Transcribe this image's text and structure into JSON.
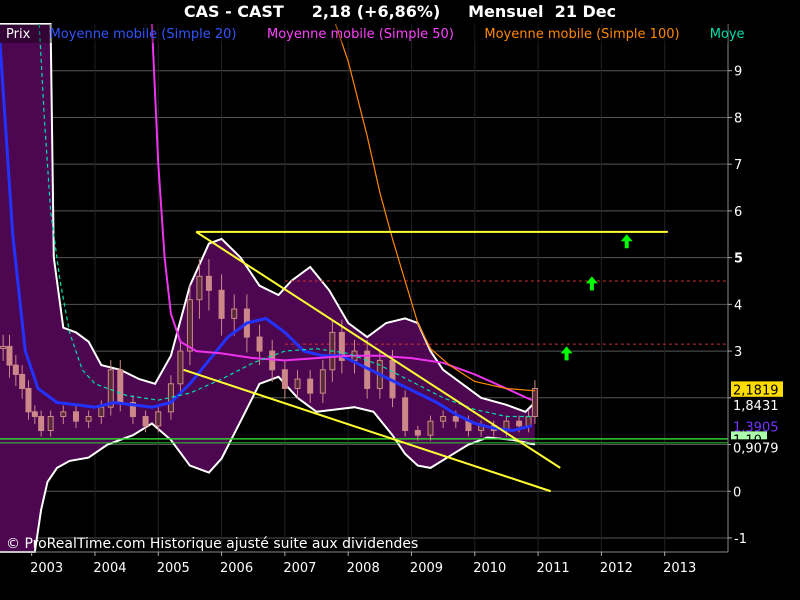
{
  "title": "CAS - CAST     2,18 (+6,86%)     Mensuel  21 Dec",
  "watermark": "© ProRealTime.com Historique ajusté suite aux dividendes",
  "legend": [
    {
      "label": "Prix",
      "color": "#ffffff"
    },
    {
      "label": "Moyenne mobile (Simple 20)",
      "color": "#3355ff"
    },
    {
      "label": "Moyenne mobile (Simple 50)",
      "color": "#ff44ff"
    },
    {
      "label": "Moyenne mobile (Simple 100)",
      "color": "#ff8800"
    },
    {
      "label": "Moye",
      "color": "#00ddaa"
    }
  ],
  "value_labels": [
    {
      "text": "2,1819",
      "value": 2.18,
      "bg": "#ffdd00",
      "color": "#000000"
    },
    {
      "text": "1,8431",
      "value": 1.85,
      "bg": "#000000",
      "color": "#ffffff"
    },
    {
      "text": "1,3905",
      "value": 1.39,
      "bg": "#000000",
      "color": "#7733ff"
    },
    {
      "text": "1,10",
      "value": 1.11,
      "bg": "#aaffaa",
      "color": "#000000"
    },
    {
      "text": "0,9079",
      "value": 0.94,
      "bg": "#000000",
      "color": "#ffffff"
    },
    {
      "text": "0",
      "value": 0,
      "bg": "#000000",
      "color": "#ffffff"
    }
  ],
  "chart_data": {
    "type": "line",
    "title": "CAS - CAST     2,18 (+6,86%)     Mensuel  21 Dec",
    "xlabel": "",
    "ylabel": "",
    "x_ticks": [
      "2003",
      "2004",
      "2005",
      "2006",
      "2007",
      "2008",
      "2009",
      "2010",
      "2011",
      "2012",
      "2013"
    ],
    "y_ticks": [
      "-1",
      "0",
      "1",
      "2",
      "3",
      "4",
      "5",
      "6",
      "7",
      "8",
      "9"
    ],
    "xlim": [
      2002.5,
      2014.0
    ],
    "ylim": [
      -1.3,
      10.0
    ],
    "grid": true,
    "colors": {
      "band_fill": "#4d0650",
      "band_edge": "#ffffff",
      "price": "#cc8888",
      "ma20": "#2233ff",
      "ma50": "#ee33ee",
      "ma100": "#ff8800",
      "ma200": "#00ddaa",
      "trendline": "#ffff33",
      "support": "#33cc33",
      "resistance": "#cc3333",
      "arrow": "#00ff00"
    },
    "price": [
      {
        "x": 2002.55,
        "y": 3.1
      },
      {
        "x": 2002.65,
        "y": 2.7
      },
      {
        "x": 2002.75,
        "y": 2.5
      },
      {
        "x": 2002.85,
        "y": 2.2
      },
      {
        "x": 2002.95,
        "y": 1.7
      },
      {
        "x": 2003.05,
        "y": 1.6
      },
      {
        "x": 2003.15,
        "y": 1.3
      },
      {
        "x": 2003.3,
        "y": 1.6
      },
      {
        "x": 2003.5,
        "y": 1.7
      },
      {
        "x": 2003.7,
        "y": 1.5
      },
      {
        "x": 2003.9,
        "y": 1.6
      },
      {
        "x": 2004.1,
        "y": 1.8
      },
      {
        "x": 2004.25,
        "y": 2.6
      },
      {
        "x": 2004.4,
        "y": 1.9
      },
      {
        "x": 2004.6,
        "y": 1.6
      },
      {
        "x": 2004.8,
        "y": 1.4
      },
      {
        "x": 2005.0,
        "y": 1.7
      },
      {
        "x": 2005.2,
        "y": 2.3
      },
      {
        "x": 2005.35,
        "y": 3.0
      },
      {
        "x": 2005.5,
        "y": 4.1
      },
      {
        "x": 2005.65,
        "y": 4.6
      },
      {
        "x": 2005.8,
        "y": 4.3
      },
      {
        "x": 2006.0,
        "y": 3.7
      },
      {
        "x": 2006.2,
        "y": 3.9
      },
      {
        "x": 2006.4,
        "y": 3.3
      },
      {
        "x": 2006.6,
        "y": 3.0
      },
      {
        "x": 2006.8,
        "y": 2.6
      },
      {
        "x": 2007.0,
        "y": 2.2
      },
      {
        "x": 2007.2,
        "y": 2.4
      },
      {
        "x": 2007.4,
        "y": 2.1
      },
      {
        "x": 2007.6,
        "y": 2.6
      },
      {
        "x": 2007.75,
        "y": 3.4
      },
      {
        "x": 2007.9,
        "y": 2.8
      },
      {
        "x": 2008.1,
        "y": 3.0
      },
      {
        "x": 2008.3,
        "y": 2.2
      },
      {
        "x": 2008.5,
        "y": 2.8
      },
      {
        "x": 2008.7,
        "y": 2.0
      },
      {
        "x": 2008.9,
        "y": 1.3
      },
      {
        "x": 2009.1,
        "y": 1.2
      },
      {
        "x": 2009.3,
        "y": 1.5
      },
      {
        "x": 2009.5,
        "y": 1.6
      },
      {
        "x": 2009.7,
        "y": 1.5
      },
      {
        "x": 2009.9,
        "y": 1.3
      },
      {
        "x": 2010.1,
        "y": 1.4
      },
      {
        "x": 2010.3,
        "y": 1.3
      },
      {
        "x": 2010.5,
        "y": 1.5
      },
      {
        "x": 2010.7,
        "y": 1.4
      },
      {
        "x": 2010.85,
        "y": 1.6
      },
      {
        "x": 2010.95,
        "y": 2.2
      }
    ],
    "series": [
      {
        "name": "Moyenne mobile (Simple 20)",
        "color": "#2233ff",
        "points": [
          {
            "x": 2002.5,
            "y": 9.6
          },
          {
            "x": 2002.7,
            "y": 5.5
          },
          {
            "x": 2002.9,
            "y": 3.0
          },
          {
            "x": 2003.1,
            "y": 2.2
          },
          {
            "x": 2003.4,
            "y": 1.9
          },
          {
            "x": 2003.7,
            "y": 1.85
          },
          {
            "x": 2004.0,
            "y": 1.8
          },
          {
            "x": 2004.3,
            "y": 1.9
          },
          {
            "x": 2004.6,
            "y": 1.85
          },
          {
            "x": 2004.9,
            "y": 1.8
          },
          {
            "x": 2005.2,
            "y": 1.9
          },
          {
            "x": 2005.5,
            "y": 2.3
          },
          {
            "x": 2005.8,
            "y": 2.8
          },
          {
            "x": 2006.1,
            "y": 3.3
          },
          {
            "x": 2006.4,
            "y": 3.6
          },
          {
            "x": 2006.7,
            "y": 3.7
          },
          {
            "x": 2007.0,
            "y": 3.4
          },
          {
            "x": 2007.3,
            "y": 3.0
          },
          {
            "x": 2007.6,
            "y": 2.9
          },
          {
            "x": 2007.9,
            "y": 2.9
          },
          {
            "x": 2008.2,
            "y": 2.7
          },
          {
            "x": 2008.5,
            "y": 2.5
          },
          {
            "x": 2008.8,
            "y": 2.3
          },
          {
            "x": 2009.1,
            "y": 2.1
          },
          {
            "x": 2009.4,
            "y": 1.9
          },
          {
            "x": 2009.7,
            "y": 1.65
          },
          {
            "x": 2010.0,
            "y": 1.45
          },
          {
            "x": 2010.3,
            "y": 1.35
          },
          {
            "x": 2010.6,
            "y": 1.3
          },
          {
            "x": 2010.9,
            "y": 1.4
          }
        ]
      },
      {
        "name": "Moyenne mobile (Simple 50)",
        "color": "#ee33ee",
        "points": [
          {
            "x": 2004.9,
            "y": 10.0
          },
          {
            "x": 2005.0,
            "y": 7.0
          },
          {
            "x": 2005.1,
            "y": 5.0
          },
          {
            "x": 2005.2,
            "y": 3.8
          },
          {
            "x": 2005.35,
            "y": 3.2
          },
          {
            "x": 2005.6,
            "y": 3.0
          },
          {
            "x": 2006.0,
            "y": 2.95
          },
          {
            "x": 2006.5,
            "y": 2.85
          },
          {
            "x": 2007.0,
            "y": 2.8
          },
          {
            "x": 2007.5,
            "y": 2.85
          },
          {
            "x": 2008.0,
            "y": 2.9
          },
          {
            "x": 2008.5,
            "y": 2.9
          },
          {
            "x": 2009.0,
            "y": 2.85
          },
          {
            "x": 2009.5,
            "y": 2.75
          },
          {
            "x": 2010.0,
            "y": 2.5
          },
          {
            "x": 2010.5,
            "y": 2.2
          },
          {
            "x": 2010.9,
            "y": 1.95
          }
        ]
      },
      {
        "name": "Moyenne mobile (Simple 100)",
        "color": "#ff8800",
        "points": [
          {
            "x": 2007.8,
            "y": 10.0
          },
          {
            "x": 2008.0,
            "y": 9.2
          },
          {
            "x": 2008.3,
            "y": 7.6
          },
          {
            "x": 2008.5,
            "y": 6.4
          },
          {
            "x": 2008.7,
            "y": 5.4
          },
          {
            "x": 2008.9,
            "y": 4.5
          },
          {
            "x": 2009.1,
            "y": 3.6
          },
          {
            "x": 2009.3,
            "y": 3.05
          },
          {
            "x": 2009.6,
            "y": 2.7
          },
          {
            "x": 2010.0,
            "y": 2.35
          },
          {
            "x": 2010.5,
            "y": 2.2
          },
          {
            "x": 2010.95,
            "y": 2.15
          }
        ]
      },
      {
        "name": "Moye",
        "color": "#00ddaa",
        "points": [
          {
            "x": 2003.12,
            "y": 10.0
          },
          {
            "x": 2003.2,
            "y": 8.0
          },
          {
            "x": 2003.3,
            "y": 6.0
          },
          {
            "x": 2003.45,
            "y": 4.5
          },
          {
            "x": 2003.6,
            "y": 3.4
          },
          {
            "x": 2003.8,
            "y": 2.6
          },
          {
            "x": 2004.0,
            "y": 2.3
          },
          {
            "x": 2004.5,
            "y": 2.05
          },
          {
            "x": 2005.0,
            "y": 1.95
          },
          {
            "x": 2005.5,
            "y": 2.1
          },
          {
            "x": 2006.0,
            "y": 2.4
          },
          {
            "x": 2006.5,
            "y": 2.75
          },
          {
            "x": 2007.0,
            "y": 3.0
          },
          {
            "x": 2007.5,
            "y": 3.05
          },
          {
            "x": 2008.0,
            "y": 2.95
          },
          {
            "x": 2008.5,
            "y": 2.7
          },
          {
            "x": 2009.0,
            "y": 2.35
          },
          {
            "x": 2009.5,
            "y": 2.0
          },
          {
            "x": 2010.0,
            "y": 1.75
          },
          {
            "x": 2010.5,
            "y": 1.6
          },
          {
            "x": 2010.9,
            "y": 1.6
          }
        ]
      }
    ],
    "band_upper": [
      {
        "x": 2002.5,
        "y": 10.0
      },
      {
        "x": 2003.3,
        "y": 10.0
      },
      {
        "x": 2003.35,
        "y": 5.0
      },
      {
        "x": 2003.5,
        "y": 3.5
      },
      {
        "x": 2003.7,
        "y": 3.4
      },
      {
        "x": 2003.9,
        "y": 3.2
      },
      {
        "x": 2004.1,
        "y": 2.7
      },
      {
        "x": 2004.4,
        "y": 2.6
      },
      {
        "x": 2004.7,
        "y": 2.4
      },
      {
        "x": 2004.95,
        "y": 2.3
      },
      {
        "x": 2005.2,
        "y": 2.9
      },
      {
        "x": 2005.5,
        "y": 4.4
      },
      {
        "x": 2005.8,
        "y": 5.3
      },
      {
        "x": 2006.0,
        "y": 5.4
      },
      {
        "x": 2006.3,
        "y": 5.0
      },
      {
        "x": 2006.6,
        "y": 4.4
      },
      {
        "x": 2006.9,
        "y": 4.2
      },
      {
        "x": 2007.1,
        "y": 4.5
      },
      {
        "x": 2007.4,
        "y": 4.8
      },
      {
        "x": 2007.7,
        "y": 4.3
      },
      {
        "x": 2008.0,
        "y": 3.6
      },
      {
        "x": 2008.3,
        "y": 3.3
      },
      {
        "x": 2008.6,
        "y": 3.6
      },
      {
        "x": 2008.9,
        "y": 3.7
      },
      {
        "x": 2009.1,
        "y": 3.6
      },
      {
        "x": 2009.3,
        "y": 3.0
      },
      {
        "x": 2009.5,
        "y": 2.6
      },
      {
        "x": 2009.8,
        "y": 2.3
      },
      {
        "x": 2010.1,
        "y": 2.0
      },
      {
        "x": 2010.5,
        "y": 1.85
      },
      {
        "x": 2010.8,
        "y": 1.7
      },
      {
        "x": 2010.95,
        "y": 1.9
      }
    ],
    "band_lower": [
      {
        "x": 2002.5,
        "y": -1.3
      },
      {
        "x": 2003.05,
        "y": -1.3
      },
      {
        "x": 2003.15,
        "y": -0.4
      },
      {
        "x": 2003.25,
        "y": 0.2
      },
      {
        "x": 2003.4,
        "y": 0.5
      },
      {
        "x": 2003.6,
        "y": 0.65
      },
      {
        "x": 2003.9,
        "y": 0.72
      },
      {
        "x": 2004.2,
        "y": 1.0
      },
      {
        "x": 2004.6,
        "y": 1.2
      },
      {
        "x": 2004.9,
        "y": 1.45
      },
      {
        "x": 2005.2,
        "y": 1.1
      },
      {
        "x": 2005.5,
        "y": 0.55
      },
      {
        "x": 2005.8,
        "y": 0.4
      },
      {
        "x": 2006.0,
        "y": 0.7
      },
      {
        "x": 2006.3,
        "y": 1.5
      },
      {
        "x": 2006.6,
        "y": 2.3
      },
      {
        "x": 2006.9,
        "y": 2.45
      },
      {
        "x": 2007.2,
        "y": 2.0
      },
      {
        "x": 2007.5,
        "y": 1.7
      },
      {
        "x": 2007.8,
        "y": 1.75
      },
      {
        "x": 2008.1,
        "y": 1.8
      },
      {
        "x": 2008.4,
        "y": 1.7
      },
      {
        "x": 2008.7,
        "y": 1.2
      },
      {
        "x": 2008.9,
        "y": 0.8
      },
      {
        "x": 2009.1,
        "y": 0.55
      },
      {
        "x": 2009.3,
        "y": 0.5
      },
      {
        "x": 2009.6,
        "y": 0.75
      },
      {
        "x": 2009.9,
        "y": 1.0
      },
      {
        "x": 2010.2,
        "y": 1.15
      },
      {
        "x": 2010.6,
        "y": 1.1
      },
      {
        "x": 2010.95,
        "y": 1.0
      }
    ],
    "trendlines": [
      {
        "x1": 2005.6,
        "y1": 5.55,
        "x2": 2011.35,
        "y2": 0.5
      },
      {
        "x1": 2005.4,
        "y1": 2.6,
        "x2": 2011.2,
        "y2": 0.0
      },
      {
        "x1": 2005.6,
        "y1": 5.55,
        "x2": 2013.05,
        "y2": 5.55
      }
    ],
    "support_level": 1.12,
    "resistance_levels": [
      3.15,
      4.5
    ],
    "arrows": [
      {
        "x": 2011.45,
        "y": 2.95
      },
      {
        "x": 2011.85,
        "y": 4.45
      },
      {
        "x": 2012.4,
        "y": 5.35
      }
    ]
  }
}
